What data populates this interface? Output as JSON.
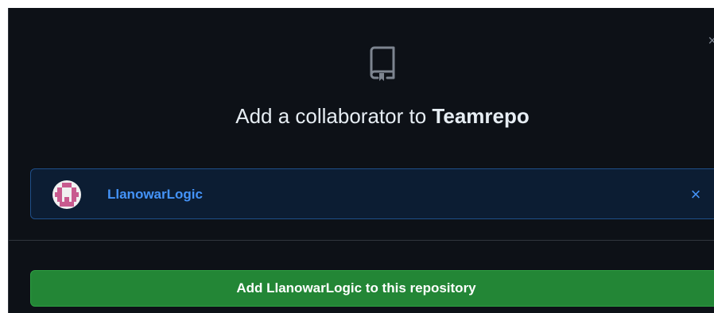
{
  "dialog": {
    "title_prefix": "Add a collaborator to ",
    "repo_name": "Teamrepo",
    "close_icon": "×",
    "repo_icon": "repo-icon"
  },
  "selected_user": {
    "username": "LlanowarLogic",
    "remove_icon": "×"
  },
  "add_button": {
    "label": "Add LlanowarLogic to this repository"
  },
  "colors": {
    "background": "#0d1117",
    "title_text": "#e6edf3",
    "link_blue": "#4493f8",
    "selected_bg": "#0c1d33",
    "selected_border": "#1f4f8a",
    "button_green": "#238636",
    "avatar_pink": "#c85a8e"
  }
}
